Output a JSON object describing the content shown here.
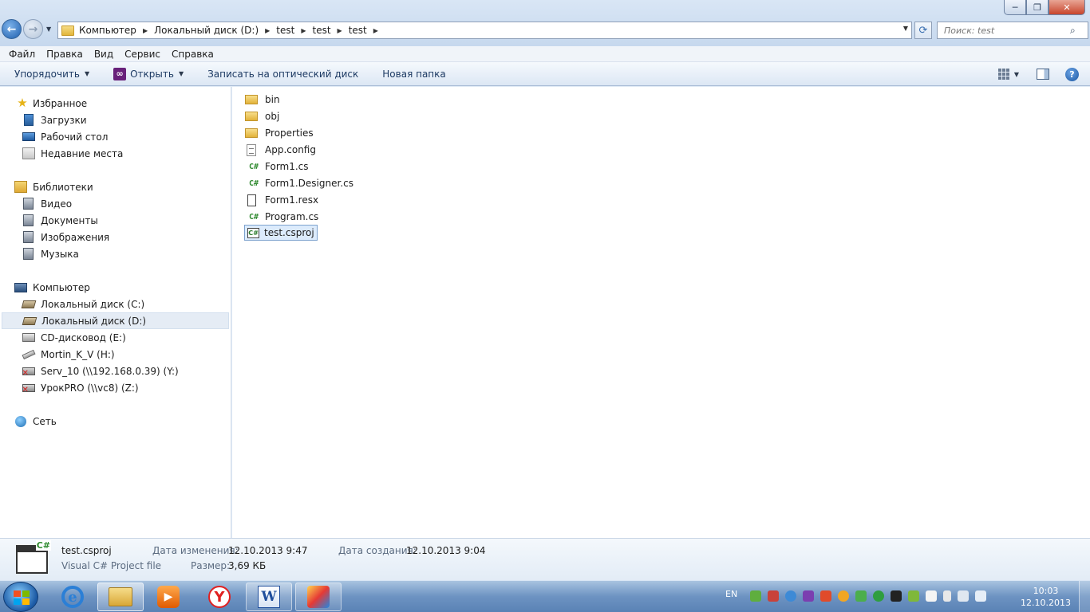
{
  "window": {
    "minimize_glyph": "─",
    "maximize_glyph": "❐",
    "close_glyph": "✕"
  },
  "nav": {
    "back_glyph": "←",
    "forward_glyph": "→",
    "dropdown_glyph": "▼"
  },
  "address": {
    "breadcrumbs": [
      "Компьютер",
      "Локальный диск (D:)",
      "test",
      "test",
      "test"
    ],
    "separator": "▶"
  },
  "search": {
    "placeholder": "Поиск: test"
  },
  "menu": [
    "Файл",
    "Правка",
    "Вид",
    "Сервис",
    "Справка"
  ],
  "commands": {
    "organize": "Упорядочить",
    "open": "Открыть",
    "burn": "Записать на оптический диск",
    "new_folder": "Новая папка",
    "help_glyph": "?"
  },
  "navpane": {
    "favorites": {
      "label": "Избранное",
      "items": [
        "Загрузки",
        "Рабочий стол",
        "Недавние места"
      ]
    },
    "libraries": {
      "label": "Библиотеки",
      "items": [
        "Видео",
        "Документы",
        "Изображения",
        "Музыка"
      ]
    },
    "computer": {
      "label": "Компьютер",
      "items": [
        "Локальный диск (C:)",
        "Локальный диск (D:)",
        "CD-дисковод (E:)",
        "Mortin_K_V (H:)",
        "Serv_10 (\\\\192.168.0.39) (Y:)",
        "УрокPRO (\\\\vc8) (Z:)"
      ],
      "selected": "Локальный диск (D:)"
    },
    "network": {
      "label": "Сеть"
    }
  },
  "files": [
    {
      "name": "bin",
      "icon": "folder-icon"
    },
    {
      "name": "obj",
      "icon": "folder-icon"
    },
    {
      "name": "Properties",
      "icon": "folder-icon"
    },
    {
      "name": "App.config",
      "icon": "config-file-icon"
    },
    {
      "name": "Form1.cs",
      "icon": "csharp-file-icon"
    },
    {
      "name": "Form1.Designer.cs",
      "icon": "csharp-file-icon"
    },
    {
      "name": "Form1.resx",
      "icon": "resx-file-icon"
    },
    {
      "name": "Program.cs",
      "icon": "csharp-file-icon"
    },
    {
      "name": "test.csproj",
      "icon": "csproj-file-icon",
      "selected": true
    }
  ],
  "details": {
    "icon_badge": "C#",
    "name": "test.csproj",
    "type": "Visual C# Project file",
    "modified_label": "Дата изменения:",
    "modified_value": "12.10.2013 9:47",
    "size_label": "Размер:",
    "size_value": "3,69 КБ",
    "created_label": "Дата создания:",
    "created_value": "12.10.2013 9:04"
  },
  "taskbar": {
    "ie_glyph": "e",
    "media_glyph": "▶",
    "yandex_glyph": "Y",
    "word_glyph": "W",
    "language": "EN",
    "time": "10:03",
    "date": "12.10.2013"
  },
  "colors": {
    "accent": "#1f5fae",
    "selection": "#dcebfc",
    "csharp_green": "#2f8a2f"
  }
}
